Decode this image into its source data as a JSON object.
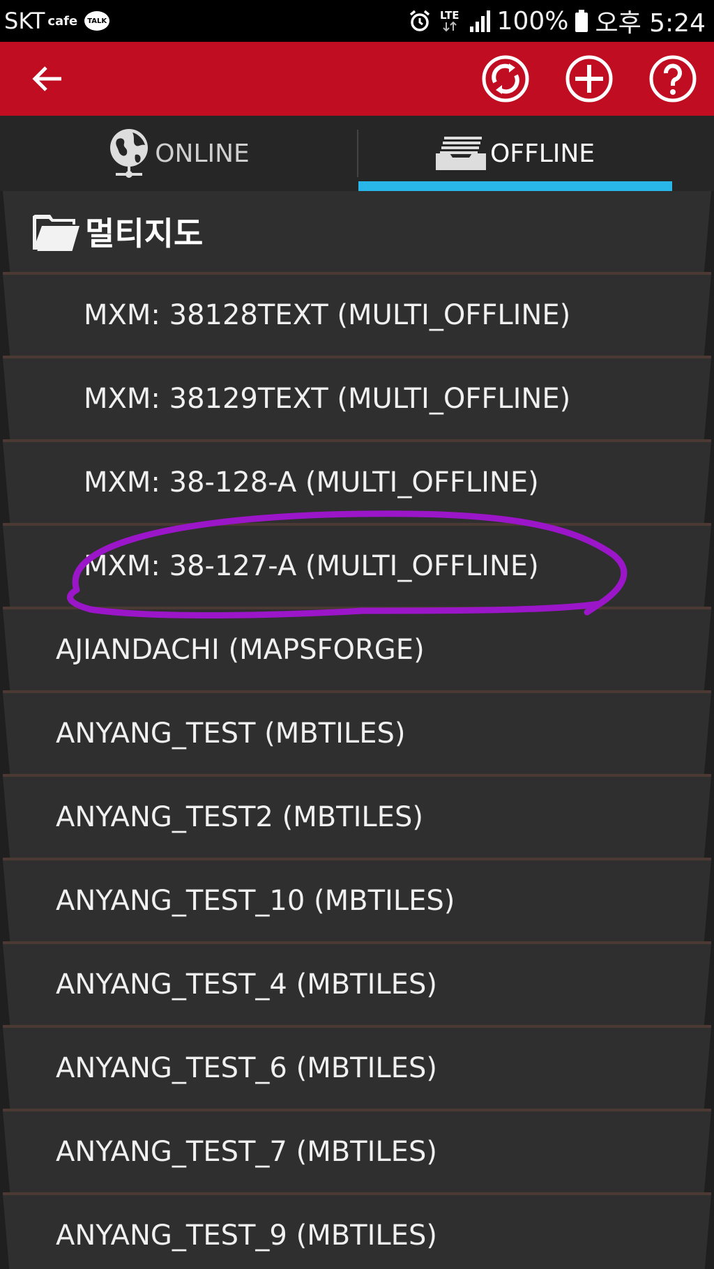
{
  "status_bar": {
    "carrier": "SKT",
    "cafe": "cafe",
    "talk": "TALK",
    "lte": "LTE",
    "battery": "100%",
    "time": "오후 5:24",
    "icons": [
      "alarm-icon",
      "lte-icon",
      "signal-icon",
      "battery-icon"
    ]
  },
  "app_bar": {
    "color": "#c00d22",
    "icons": {
      "back": "arrow-left-icon",
      "sync": "sync-icon",
      "add": "plus-icon",
      "help": "help-icon"
    }
  },
  "tabs": [
    {
      "label": "ONLINE",
      "icon": "globe-icon",
      "selected": false
    },
    {
      "label": "OFFLINE",
      "icon": "tray-icon",
      "selected": true
    }
  ],
  "accent_color": "#29b6e8",
  "list": {
    "folder": {
      "label": "멀티지도",
      "icon": "folder-icon"
    },
    "children": [
      "MXM: 38128TEXT (MULTI_OFFLINE)",
      "MXM: 38129TEXT (MULTI_OFFLINE)",
      "MXM: 38-128-A (MULTI_OFFLINE)",
      "MXM: 38-127-A (MULTI_OFFLINE)"
    ],
    "items": [
      "AJIANDACHI (MAPSFORGE)",
      "ANYANG_TEST (MBTILES)",
      "ANYANG_TEST2 (MBTILES)",
      "ANYANG_TEST_10 (MBTILES)",
      "ANYANG_TEST_4 (MBTILES)",
      "ANYANG_TEST_6 (MBTILES)",
      "ANYANG_TEST_7 (MBTILES)",
      "ANYANG_TEST_9 (MBTILES)"
    ]
  },
  "annotation": {
    "color": "#9b16c8"
  }
}
